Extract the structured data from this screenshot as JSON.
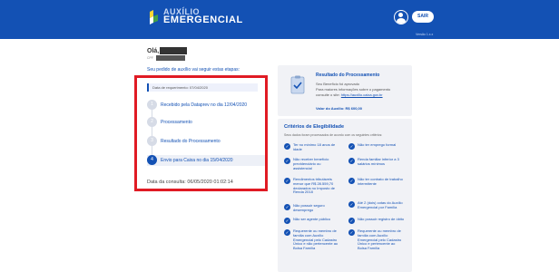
{
  "header": {
    "logo_line1": "AUXÍLIO",
    "logo_line2": "EMERGENCIAL",
    "logout_label": "SAIR",
    "version": "Versão 1.x.x"
  },
  "greeting": "Olá,",
  "cpf_label": "CPF",
  "steps_intro": "Seu pedido de auxílio vai seguir estas etapas:",
  "request_date": "Data de requerimento: 07/04/2020",
  "steps": [
    {
      "num": "1",
      "label": "Recebido pela Dataprev no dia 12/04/2020"
    },
    {
      "num": "2",
      "label": "Processamento"
    },
    {
      "num": "3",
      "label": "Resultado do Processamento"
    },
    {
      "num": "4",
      "label": "Envio para Caixa no dia 15/04/2020"
    }
  ],
  "consult_date": "Data da consulta: 06/05/2020 01:02:14",
  "result": {
    "title": "Resultado do Processamento",
    "line1": "Seu Benefício foi aprovado",
    "line2": "Para maiores informações sobre o pagamento",
    "line3_prefix": "consulte o site:",
    "link": "https://auxilio.caixa.gov.br",
    "amount": "Valor do Auxílio: R$ 600,00"
  },
  "criteria": {
    "title": "Critérios de Elegibilidade",
    "subtitle": "Seus dados foram processados de acordo com os seguintes critérios:",
    "left": [
      "Ter no mínimo 18 anos de idade",
      "Não receber benefício previdenciário ou assistencial",
      "Rendimentos tributáveis menor que R$ 28.559,70 declarados no Imposto de Renda 2018",
      "Não possuir seguro desemprego",
      "Não ser agente público",
      "Requerente ou membro de família com Auxílio Emergencial pelo Cadastro Único e não pertencente ao Bolsa Família"
    ],
    "right": [
      "Não ter emprego formal",
      "Renda familiar inferior a 3 salários mínimos",
      "Não ter contrato de trabalho intermitente",
      "Até 2 (dois) cotas do Auxílio Emergencial por Família",
      "Não possuir registro de óbito",
      "Requerente ou membro de família com Auxílio Emergencial pelo Cadastro Único e pertencente ao Bolsa Família"
    ]
  }
}
